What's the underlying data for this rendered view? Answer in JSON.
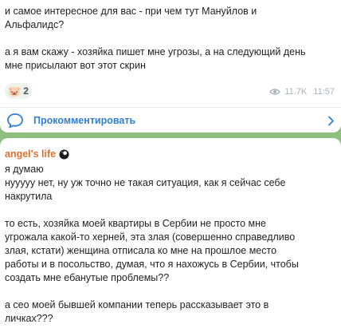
{
  "message1": {
    "paragraphs": [
      [
        "и самое интересное для вас - при чем тут Мануйлов и",
        "Альфалидс?"
      ],
      [
        "а я вам скажу - хозяйка пишет мне угрозы, а на следующий день",
        "мне присылают вот этот скрин"
      ]
    ],
    "reaction": {
      "emoji": "🐷",
      "count": "2"
    },
    "views": "11.7K",
    "time": "11:57",
    "comment_label": "Прокомментировать"
  },
  "message2": {
    "author": "angel's life",
    "author_emoji_icon": "8-ball-icon",
    "paragraphs": [
      [
        "я думаю",
        "нууууу нет, ну уж точно не такая ситуация, как я сейчас себе",
        "накрутила"
      ],
      [
        "то есть, хозяйка моей квартиры в Сербии не просто мне",
        "угрожала какой-то херней, эта злая (совершенно справедливо",
        "злая, кстати) женщина отписала ко мне на прошлое место",
        "работы и в посольство, думая, что я нахожусь в Сербии, чтобы",
        "создать мне ебанутые проблемы??"
      ],
      [
        "а сео моей бывшей компании теперь рассказывает это в",
        "личках???"
      ]
    ]
  },
  "colors": {
    "background": "#8fbf7e",
    "link": "#2f7fd4",
    "author": "#e0702d",
    "meta": "#a9b4bf"
  }
}
